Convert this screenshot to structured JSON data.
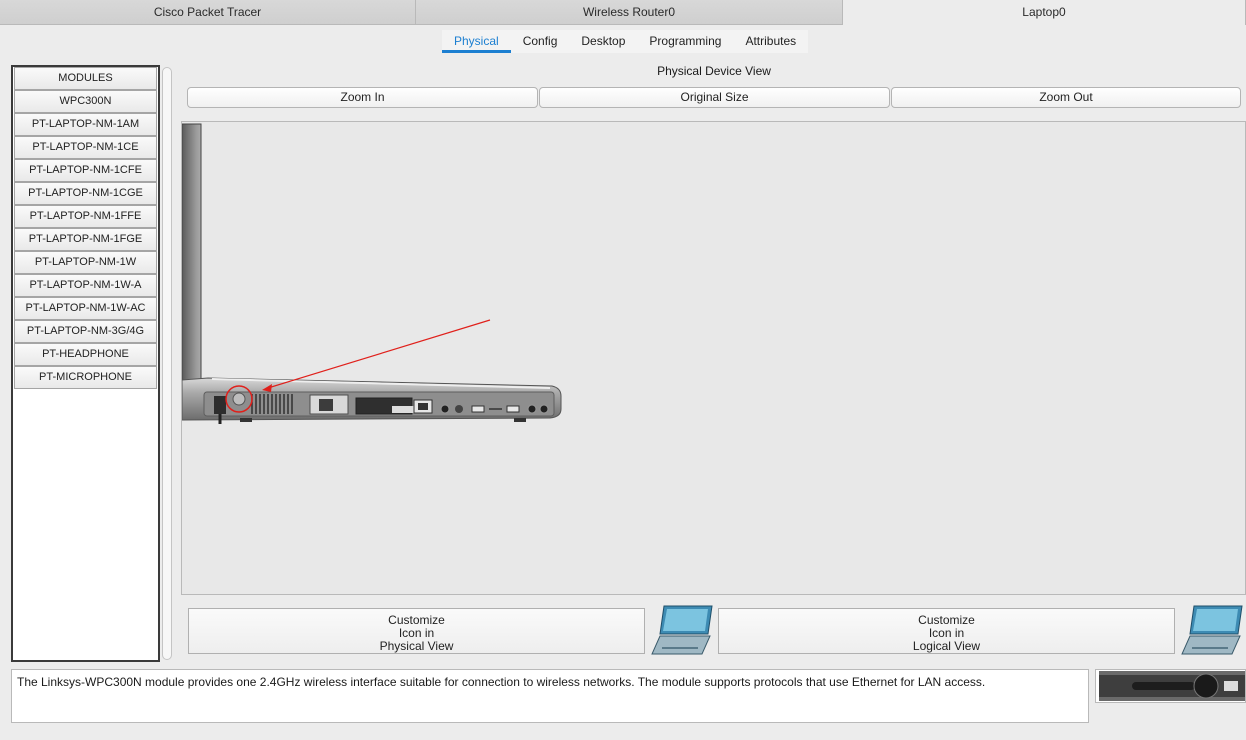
{
  "window_tabs": [
    {
      "label": "Cisco Packet Tracer"
    },
    {
      "label": "Wireless Router0"
    },
    {
      "label": "Laptop0"
    }
  ],
  "inner_tabs": [
    "Physical",
    "Config",
    "Desktop",
    "Programming",
    "Attributes"
  ],
  "modules": {
    "header": "MODULES",
    "items": [
      "WPC300N",
      "PT-LAPTOP-NM-1AM",
      "PT-LAPTOP-NM-1CE",
      "PT-LAPTOP-NM-1CFE",
      "PT-LAPTOP-NM-1CGE",
      "PT-LAPTOP-NM-1FFE",
      "PT-LAPTOP-NM-1FGE",
      "PT-LAPTOP-NM-1W",
      "PT-LAPTOP-NM-1W-A",
      "PT-LAPTOP-NM-1W-AC",
      "PT-LAPTOP-NM-3G/4G",
      "PT-HEADPHONE",
      "PT-MICROPHONE"
    ]
  },
  "physical_view": {
    "title": "Physical Device View",
    "zoom_in": "Zoom In",
    "original_size": "Original Size",
    "zoom_out": "Zoom Out"
  },
  "customize": {
    "physical": [
      "Customize",
      "Icon in",
      "Physical View"
    ],
    "logical": [
      "Customize",
      "Icon in",
      "Logical View"
    ]
  },
  "description": "The Linksys-WPC300N module provides one 2.4GHz wireless interface suitable for connection to wireless networks. The module supports protocols that use Ethernet for LAN access.",
  "colors": {
    "accent": "#1c7fd1",
    "annotation": "#e0201b"
  }
}
